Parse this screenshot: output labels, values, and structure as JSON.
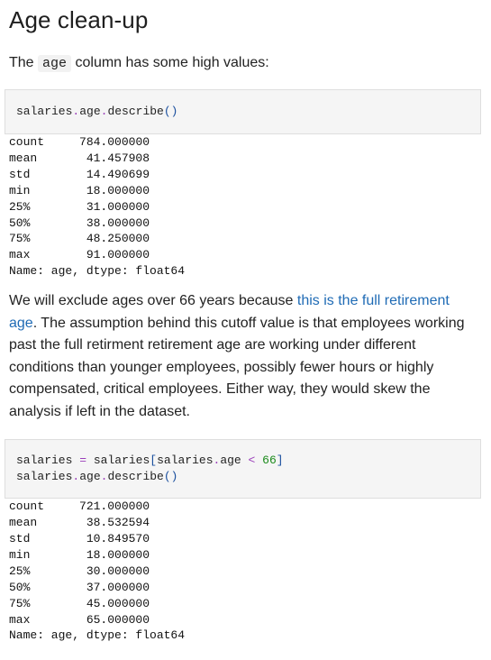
{
  "title": "Age clean-up",
  "intro": {
    "before": "The",
    "code": "age",
    "after": "column has some high values:"
  },
  "cell1": {
    "obj": "salaries",
    "dot1": ".",
    "attr": "age",
    "dot2": ".",
    "method": "describe",
    "parens": "()"
  },
  "output1": {
    "rows": [
      {
        "label": "count",
        "value": "784.000000"
      },
      {
        "label": "mean",
        "value": "41.457908"
      },
      {
        "label": "std",
        "value": "14.490699"
      },
      {
        "label": "min",
        "value": "18.000000"
      },
      {
        "label": "25%",
        "value": "31.000000"
      },
      {
        "label": "50%",
        "value": "38.000000"
      },
      {
        "label": "75%",
        "value": "48.250000"
      },
      {
        "label": "max",
        "value": "91.000000"
      }
    ],
    "footer": "Name: age, dtype: float64"
  },
  "paragraph": {
    "before": "We will exclude ages over 66 years because ",
    "link": "this is the full retirement age",
    "after": ". The assumption behind this cutoff value is that employees working past the full retirment retirement age are working under different conditions than younger employees, possibly fewer hours or highly compensated, critical employees. Either way, they would skew the analysis if left in the dataset."
  },
  "cell2": {
    "line1": {
      "var": "salaries",
      "assign": "=",
      "obj": "salaries",
      "lbracket": "[",
      "inner_obj": "salaries",
      "dot": ".",
      "attr": "age",
      "lt": "<",
      "num": "66",
      "rbracket": "]"
    },
    "line2": {
      "obj": "salaries",
      "dot1": ".",
      "attr": "age",
      "dot2": ".",
      "method": "describe",
      "parens": "()"
    }
  },
  "output2": {
    "rows": [
      {
        "label": "count",
        "value": "721.000000"
      },
      {
        "label": "mean",
        "value": "38.532594"
      },
      {
        "label": "std",
        "value": "10.849570"
      },
      {
        "label": "min",
        "value": "18.000000"
      },
      {
        "label": "25%",
        "value": "30.000000"
      },
      {
        "label": "50%",
        "value": "37.000000"
      },
      {
        "label": "75%",
        "value": "45.000000"
      },
      {
        "label": "max",
        "value": "65.000000"
      }
    ],
    "footer": "Name: age, dtype: float64"
  }
}
